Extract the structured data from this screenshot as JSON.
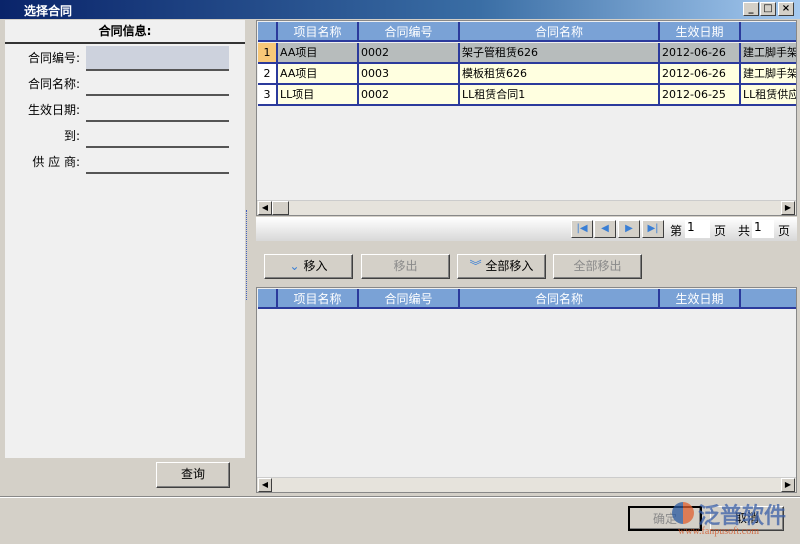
{
  "window": {
    "title": "选择合同"
  },
  "filter": {
    "heading": "合同信息:",
    "fields": [
      {
        "label": "合同编号:",
        "value": ""
      },
      {
        "label": "合同名称:",
        "value": ""
      },
      {
        "label": "生效日期:",
        "value": ""
      },
      {
        "label": "到:",
        "value": ""
      },
      {
        "label": "供 应 商:",
        "value": ""
      }
    ],
    "query_label": "查询"
  },
  "grid1": {
    "columns": [
      "项目名称",
      "合同编号",
      "合同名称",
      "生效日期",
      ""
    ],
    "rows": [
      {
        "n": "1",
        "project": "AA项目",
        "code": "0002",
        "name": "架子管租赁626",
        "date": "2012-06-26",
        "supplier": "建工脚手架"
      },
      {
        "n": "2",
        "project": "AA项目",
        "code": "0003",
        "name": "模板租赁626",
        "date": "2012-06-26",
        "supplier": "建工脚手架"
      },
      {
        "n": "3",
        "project": "LL项目",
        "code": "0002",
        "name": "LL租赁合同1",
        "date": "2012-06-25",
        "supplier": "LL租赁供应商"
      }
    ]
  },
  "pager": {
    "page_prefix": "第",
    "page": "1",
    "page_suffix": "页",
    "total_prefix": "共",
    "total": "1",
    "total_suffix": "页"
  },
  "actions": {
    "move_in": "移入",
    "move_out": "移出",
    "move_all_in": "全部移入",
    "move_all_out": "全部移出"
  },
  "grid2": {
    "columns": [
      "项目名称",
      "合同编号",
      "合同名称",
      "生效日期",
      ""
    ]
  },
  "footer": {
    "ok": "确定",
    "cancel": "取消"
  },
  "watermark": {
    "brand": "泛普软件",
    "url": "www.fanpusoft.com"
  },
  "colors": {
    "header": "#7aa2d6",
    "selected_row": "#b7bcbc",
    "row": "#ffffe0",
    "grid_line": "#2b3a9c"
  }
}
